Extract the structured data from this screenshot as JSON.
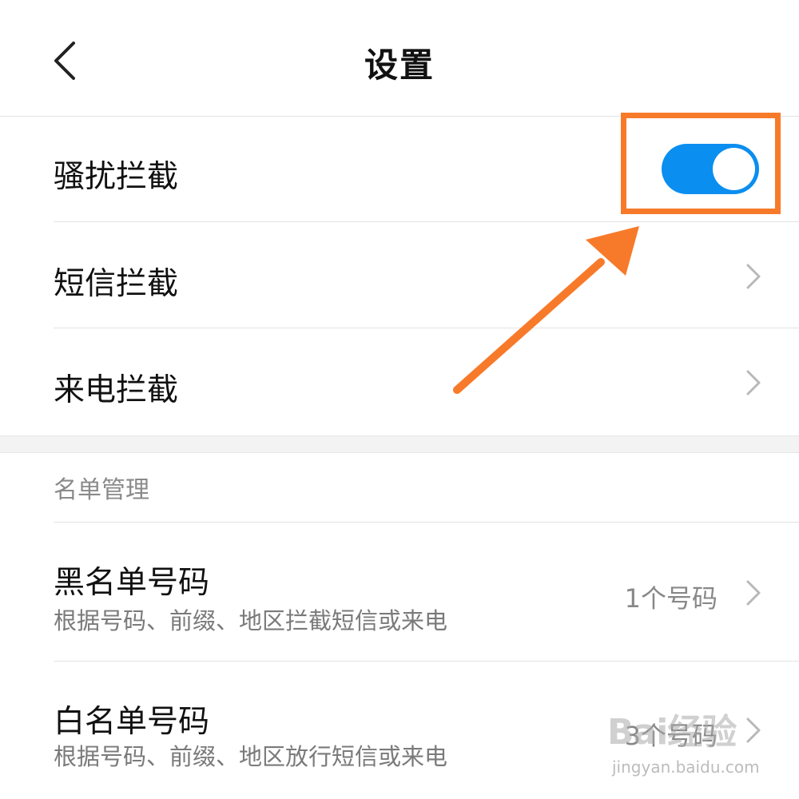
{
  "header": {
    "title": "设置",
    "back_icon": "chevron-left-icon"
  },
  "rows": {
    "harassment": {
      "label": "骚扰拦截",
      "toggle_on": true
    },
    "sms": {
      "label": "短信拦截",
      "icon": "chevron-right-icon"
    },
    "call": {
      "label": "来电拦截",
      "icon": "chevron-right-icon"
    }
  },
  "list_management": {
    "header": "名单管理",
    "blacklist": {
      "title": "黑名单号码",
      "subtitle": "根据号码、前缀、地区拦截短信或来电",
      "count": "1个号码"
    },
    "whitelist": {
      "title": "白名单号码",
      "subtitle": "根据号码、前缀、地区放行短信或来电",
      "count": "3个号码"
    }
  },
  "watermark": {
    "logo": "Bai经验",
    "url": "jingyan.baidu.com"
  },
  "colors": {
    "accent_blue": "#0a8ef0",
    "annotation_orange": "#f77a2a",
    "divider": "#e3e3e3"
  }
}
